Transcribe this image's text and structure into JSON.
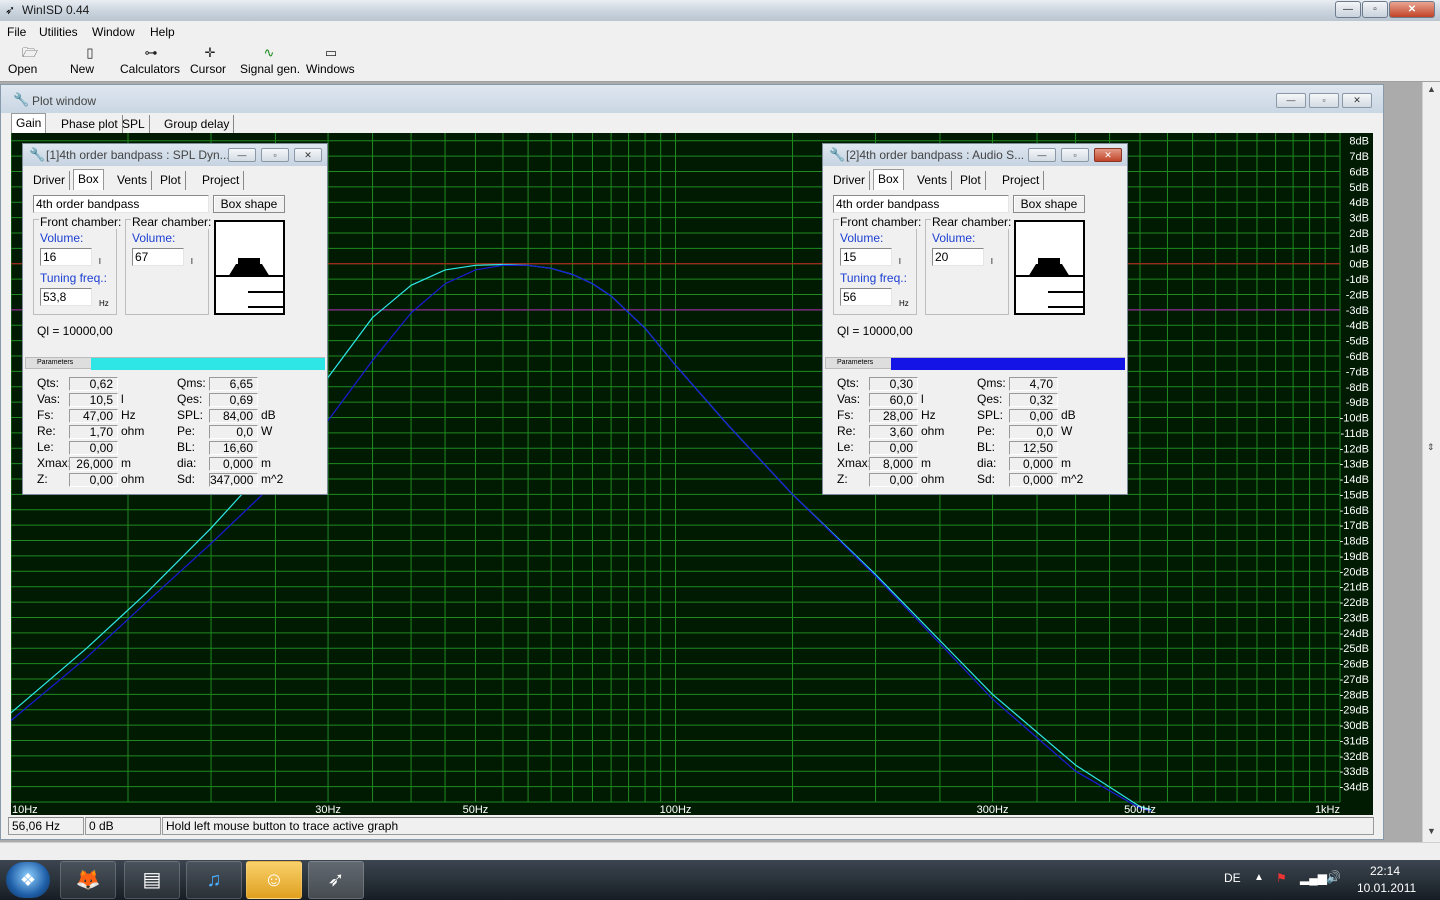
{
  "app": {
    "title": "WinISD 0.44",
    "caption_buttons": [
      "minimize-icon",
      "maximize-icon",
      "close-icon"
    ]
  },
  "menu": [
    "File",
    "Utilities",
    "Window",
    "Help"
  ],
  "toolbar": [
    {
      "label": "Open",
      "icon": "open-folder-icon"
    },
    {
      "label": "New",
      "icon": "new-document-icon"
    },
    {
      "label": "Calculators",
      "icon": "calculators-icon"
    },
    {
      "label": "Cursor",
      "icon": "cursor-icon"
    },
    {
      "label": "Signal gen.",
      "icon": "signal-generator-icon"
    },
    {
      "label": "Windows",
      "icon": "windows-icon"
    }
  ],
  "plot_window": {
    "title": "Plot window",
    "tabs": [
      "Gain",
      "Phase plot",
      "SPL",
      "Group delay"
    ],
    "active_tab": "Gain"
  },
  "chart_data": {
    "type": "line",
    "title": "",
    "xscale": "log",
    "xlim": [
      10,
      1000
    ],
    "ylim": [
      -35,
      8.5
    ],
    "x_tick_labels": [
      {
        "value": 10,
        "label": "10Hz"
      },
      {
        "value": 30,
        "label": "30Hz"
      },
      {
        "value": 50,
        "label": "50Hz"
      },
      {
        "value": 100,
        "label": "100Hz"
      },
      {
        "value": 300,
        "label": "300Hz"
      },
      {
        "value": 500,
        "label": "500Hz"
      },
      {
        "value": 1000,
        "label": "1kHz"
      }
    ],
    "y_ticks": [
      8,
      7,
      6,
      5,
      4,
      3,
      2,
      1,
      0,
      -1,
      -2,
      -3,
      -4,
      -5,
      -6,
      -7,
      -8,
      -9,
      -10,
      -11,
      -12,
      -13,
      -14,
      -15,
      -16,
      -17,
      -18,
      -19,
      -20,
      -21,
      -22,
      -23,
      -24,
      -25,
      -26,
      -27,
      -28,
      -29,
      -30,
      -31,
      -32,
      -33,
      -34
    ],
    "y_tick_suffix": "dB",
    "grid": true,
    "reference_lines": [
      {
        "y": 0,
        "color": "#c81e1e"
      },
      {
        "y": -3,
        "color": "#b020b0"
      }
    ],
    "colors": {
      "background": "#011b03",
      "grid": "#1f8a1f",
      "tick_text": "#ffffff"
    },
    "series": [
      {
        "color": "#2ee6e6",
        "x": [
          10,
          13,
          16,
          20,
          25,
          30,
          35,
          40,
          45,
          50,
          55,
          60,
          65,
          70,
          75,
          80,
          90,
          100,
          120,
          150,
          200,
          250,
          300,
          400,
          500,
          520
        ],
        "y": [
          -29.2,
          -25.0,
          -21.4,
          -17.2,
          -12.6,
          -7.4,
          -3.5,
          -1.4,
          -0.4,
          -0.1,
          -0.05,
          -0.1,
          -0.3,
          -0.7,
          -1.3,
          -2.1,
          -4.2,
          -6.6,
          -10.5,
          -15.0,
          -20.2,
          -24.5,
          -28.0,
          -32.6,
          -35.3,
          -35.5
        ]
      },
      {
        "color": "#1a1ad8",
        "x": [
          10,
          13,
          16,
          20,
          25,
          30,
          35,
          40,
          45,
          50,
          55,
          60,
          65,
          70,
          75,
          80,
          90,
          100,
          120,
          150,
          200,
          250,
          300,
          400,
          500,
          520
        ],
        "y": [
          -29.7,
          -25.6,
          -22.0,
          -18.2,
          -14.2,
          -10.2,
          -6.3,
          -3.2,
          -1.3,
          -0.4,
          -0.1,
          -0.1,
          -0.3,
          -0.7,
          -1.3,
          -2.1,
          -4.2,
          -6.6,
          -10.5,
          -15.0,
          -20.3,
          -24.7,
          -28.3,
          -33.0,
          -35.4,
          -35.6
        ]
      }
    ]
  },
  "status": {
    "freq": "56,06 Hz",
    "gain": "0 dB",
    "hint": "Hold left mouse button to trace active graph"
  },
  "project1": {
    "title": "[1]4th order bandpass : SPL Dyn...",
    "tabs": [
      "Driver",
      "Box",
      "Vents",
      "Plot",
      "Project"
    ],
    "active_tab": "Box",
    "box_type": "4th order bandpass",
    "box_shape_button": "Box shape",
    "front_chamber_label": "Front chamber:",
    "rear_chamber_label": "Rear chamber:",
    "volume_label": "Volume:",
    "tuning_label": "Tuning freq.:",
    "front_volume": "16",
    "rear_volume": "67",
    "tuning_freq": "53,8",
    "volume_unit": "l",
    "freq_unit": "Hz",
    "ql": "Ql = 10000,00",
    "parameters_label": "Parameters",
    "color": "#2ee6e6",
    "params_left": [
      {
        "name": "Qts:",
        "value": "0,62",
        "unit": ""
      },
      {
        "name": "Vas:",
        "value": "10,5",
        "unit": "l"
      },
      {
        "name": "Fs:",
        "value": "47,00",
        "unit": "Hz"
      },
      {
        "name": "Re:",
        "value": "1,70",
        "unit": "ohm"
      },
      {
        "name": "Le:",
        "value": "0,00",
        "unit": ""
      },
      {
        "name": "Xmax:",
        "value": "26,000",
        "unit": "m"
      },
      {
        "name": "Z:",
        "value": "0,00",
        "unit": "ohm"
      }
    ],
    "params_right": [
      {
        "name": "Qms:",
        "value": "6,65",
        "unit": ""
      },
      {
        "name": "Qes:",
        "value": "0,69",
        "unit": ""
      },
      {
        "name": "SPL:",
        "value": "84,00",
        "unit": "dB"
      },
      {
        "name": "Pe:",
        "value": "0,0",
        "unit": "W"
      },
      {
        "name": "BL:",
        "value": "16,60",
        "unit": ""
      },
      {
        "name": "dia:",
        "value": "0,000",
        "unit": "m"
      },
      {
        "name": "Sd:",
        "value": "347,000",
        "unit": "m^2"
      }
    ]
  },
  "project2": {
    "title": "[2]4th order bandpass : Audio S...",
    "tabs": [
      "Driver",
      "Box",
      "Vents",
      "Plot",
      "Project"
    ],
    "active_tab": "Box",
    "box_type": "4th order bandpass",
    "box_shape_button": "Box shape",
    "front_chamber_label": "Front chamber:",
    "rear_chamber_label": "Rear chamber:",
    "volume_label": "Volume:",
    "tuning_label": "Tuning freq.:",
    "front_volume": "15",
    "rear_volume": "20",
    "tuning_freq": "56",
    "volume_unit": "l",
    "freq_unit": "Hz",
    "ql": "Ql = 10000,00",
    "parameters_label": "Parameters",
    "color": "#1414e6",
    "params_left": [
      {
        "name": "Qts:",
        "value": "0,30",
        "unit": ""
      },
      {
        "name": "Vas:",
        "value": "60,0",
        "unit": "l"
      },
      {
        "name": "Fs:",
        "value": "28,00",
        "unit": "Hz"
      },
      {
        "name": "Re:",
        "value": "3,60",
        "unit": "ohm"
      },
      {
        "name": "Le:",
        "value": "0,00",
        "unit": ""
      },
      {
        "name": "Xmax:",
        "value": "8,000",
        "unit": "m"
      },
      {
        "name": "Z:",
        "value": "0,00",
        "unit": "ohm"
      }
    ],
    "params_right": [
      {
        "name": "Qms:",
        "value": "4,70",
        "unit": ""
      },
      {
        "name": "Qes:",
        "value": "0,32",
        "unit": ""
      },
      {
        "name": "SPL:",
        "value": "0,00",
        "unit": "dB"
      },
      {
        "name": "Pe:",
        "value": "0,0",
        "unit": "W"
      },
      {
        "name": "BL:",
        "value": "12,50",
        "unit": ""
      },
      {
        "name": "dia:",
        "value": "0,000",
        "unit": "m"
      },
      {
        "name": "Sd:",
        "value": "0,000",
        "unit": "m^2"
      }
    ]
  },
  "taskbar": {
    "items": [
      "start-orb-icon",
      "firefox-icon",
      "archive-icon",
      "itunes-icon",
      "messenger-icon",
      "winisd-icon"
    ],
    "language": "DE",
    "time": "22:14",
    "date": "10.01.2011"
  }
}
